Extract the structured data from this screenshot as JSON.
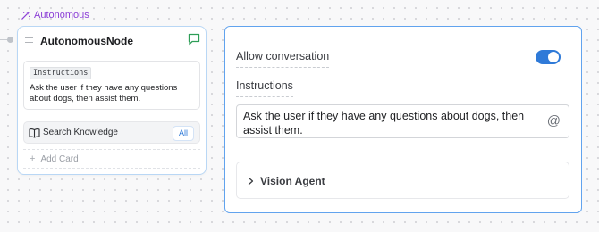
{
  "node_tag": {
    "label": "Autonomous",
    "icon": "magic-wand-icon",
    "color": "#8b3fd6"
  },
  "node": {
    "title": "AutonomousNode",
    "header_icon": "chat-bubble-icon",
    "instructions": {
      "tag": "Instructions",
      "text": "Ask the user if they have any questions about dogs, then assist them."
    },
    "knowledge": {
      "label": "Search Knowledge",
      "badge": "All",
      "icon": "book-icon"
    },
    "add_card": {
      "label": "Add Card",
      "icon": "plus-icon"
    }
  },
  "panel": {
    "allow_conversation": {
      "label": "Allow conversation",
      "enabled": true
    },
    "instructions": {
      "label": "Instructions",
      "value": "Ask the user if they have any questions about dogs, then assist them.",
      "mention_icon": "at-sign-icon",
      "mention_glyph": "@"
    },
    "vision_agent": {
      "label": "Vision Agent",
      "icon": "chevron-right-icon"
    }
  },
  "colors": {
    "accent_blue": "#2f7ad8",
    "node_border": "#b9d7f5",
    "panel_border": "#61a3ee",
    "tag_purple": "#8b3fd6",
    "chat_icon_green": "#2e9e57"
  }
}
